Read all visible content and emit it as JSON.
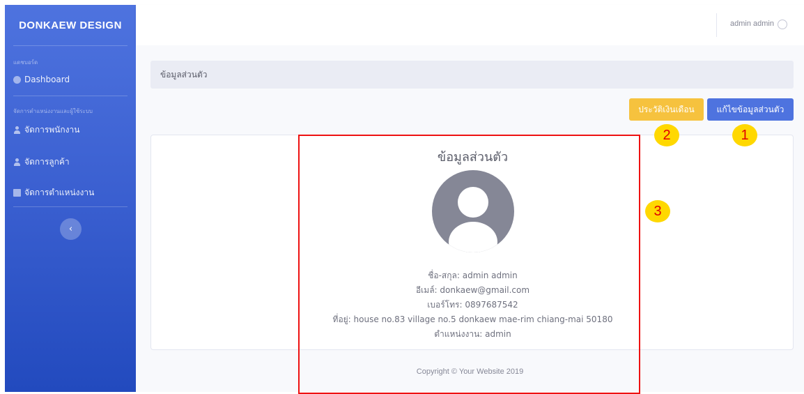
{
  "sidebar": {
    "brand": "DONKAEW DESIGN",
    "section_dashboard": "แดชบอร์ด",
    "dashboard_label": "Dashboard",
    "section_manage": "จัดการตำแหน่งงานและผู้ใช้ระบบ",
    "items": [
      {
        "label": "จัดการพนักงาน",
        "icon": "user-icon"
      },
      {
        "label": "จัดการลูกค้า",
        "icon": "user-icon"
      },
      {
        "label": "จัดการตำแหน่งงาน",
        "icon": "id-badge-icon"
      }
    ],
    "toggle_glyph": "‹"
  },
  "topbar": {
    "user_name": "admin admin"
  },
  "breadcrumb": "ข้อมูลส่วนตัว",
  "buttons": {
    "salary_history": "ประวัติเงินเดือน",
    "edit_profile": "แก้ไขข้อมูลส่วนตัว"
  },
  "profile": {
    "title": "ข้อมูลส่วนตัว",
    "name_label": "ชื่อ-สกุล: ",
    "name": "admin admin",
    "email_label": "อีเมล์: ",
    "email": "donkaew@gmail.com",
    "phone_label": "เบอร์โทร: ",
    "phone": "0897687542",
    "address_label": "ที่อยู่: ",
    "address": "house no.83 village no.5 donkaew mae-rim chiang-mai 50180",
    "position_label": "ตำแหน่งงาน: ",
    "position": "admin"
  },
  "footer": {
    "copyright": "Copyright © Your Website 2019"
  },
  "annotations": {
    "marker1": "1",
    "marker2": "2",
    "marker3": "3"
  },
  "colors": {
    "primary": "#4e73df",
    "warning": "#f6c23e",
    "highlight": "#ee1111",
    "marker_bg": "#ffd800",
    "marker_text": "#e00000"
  }
}
